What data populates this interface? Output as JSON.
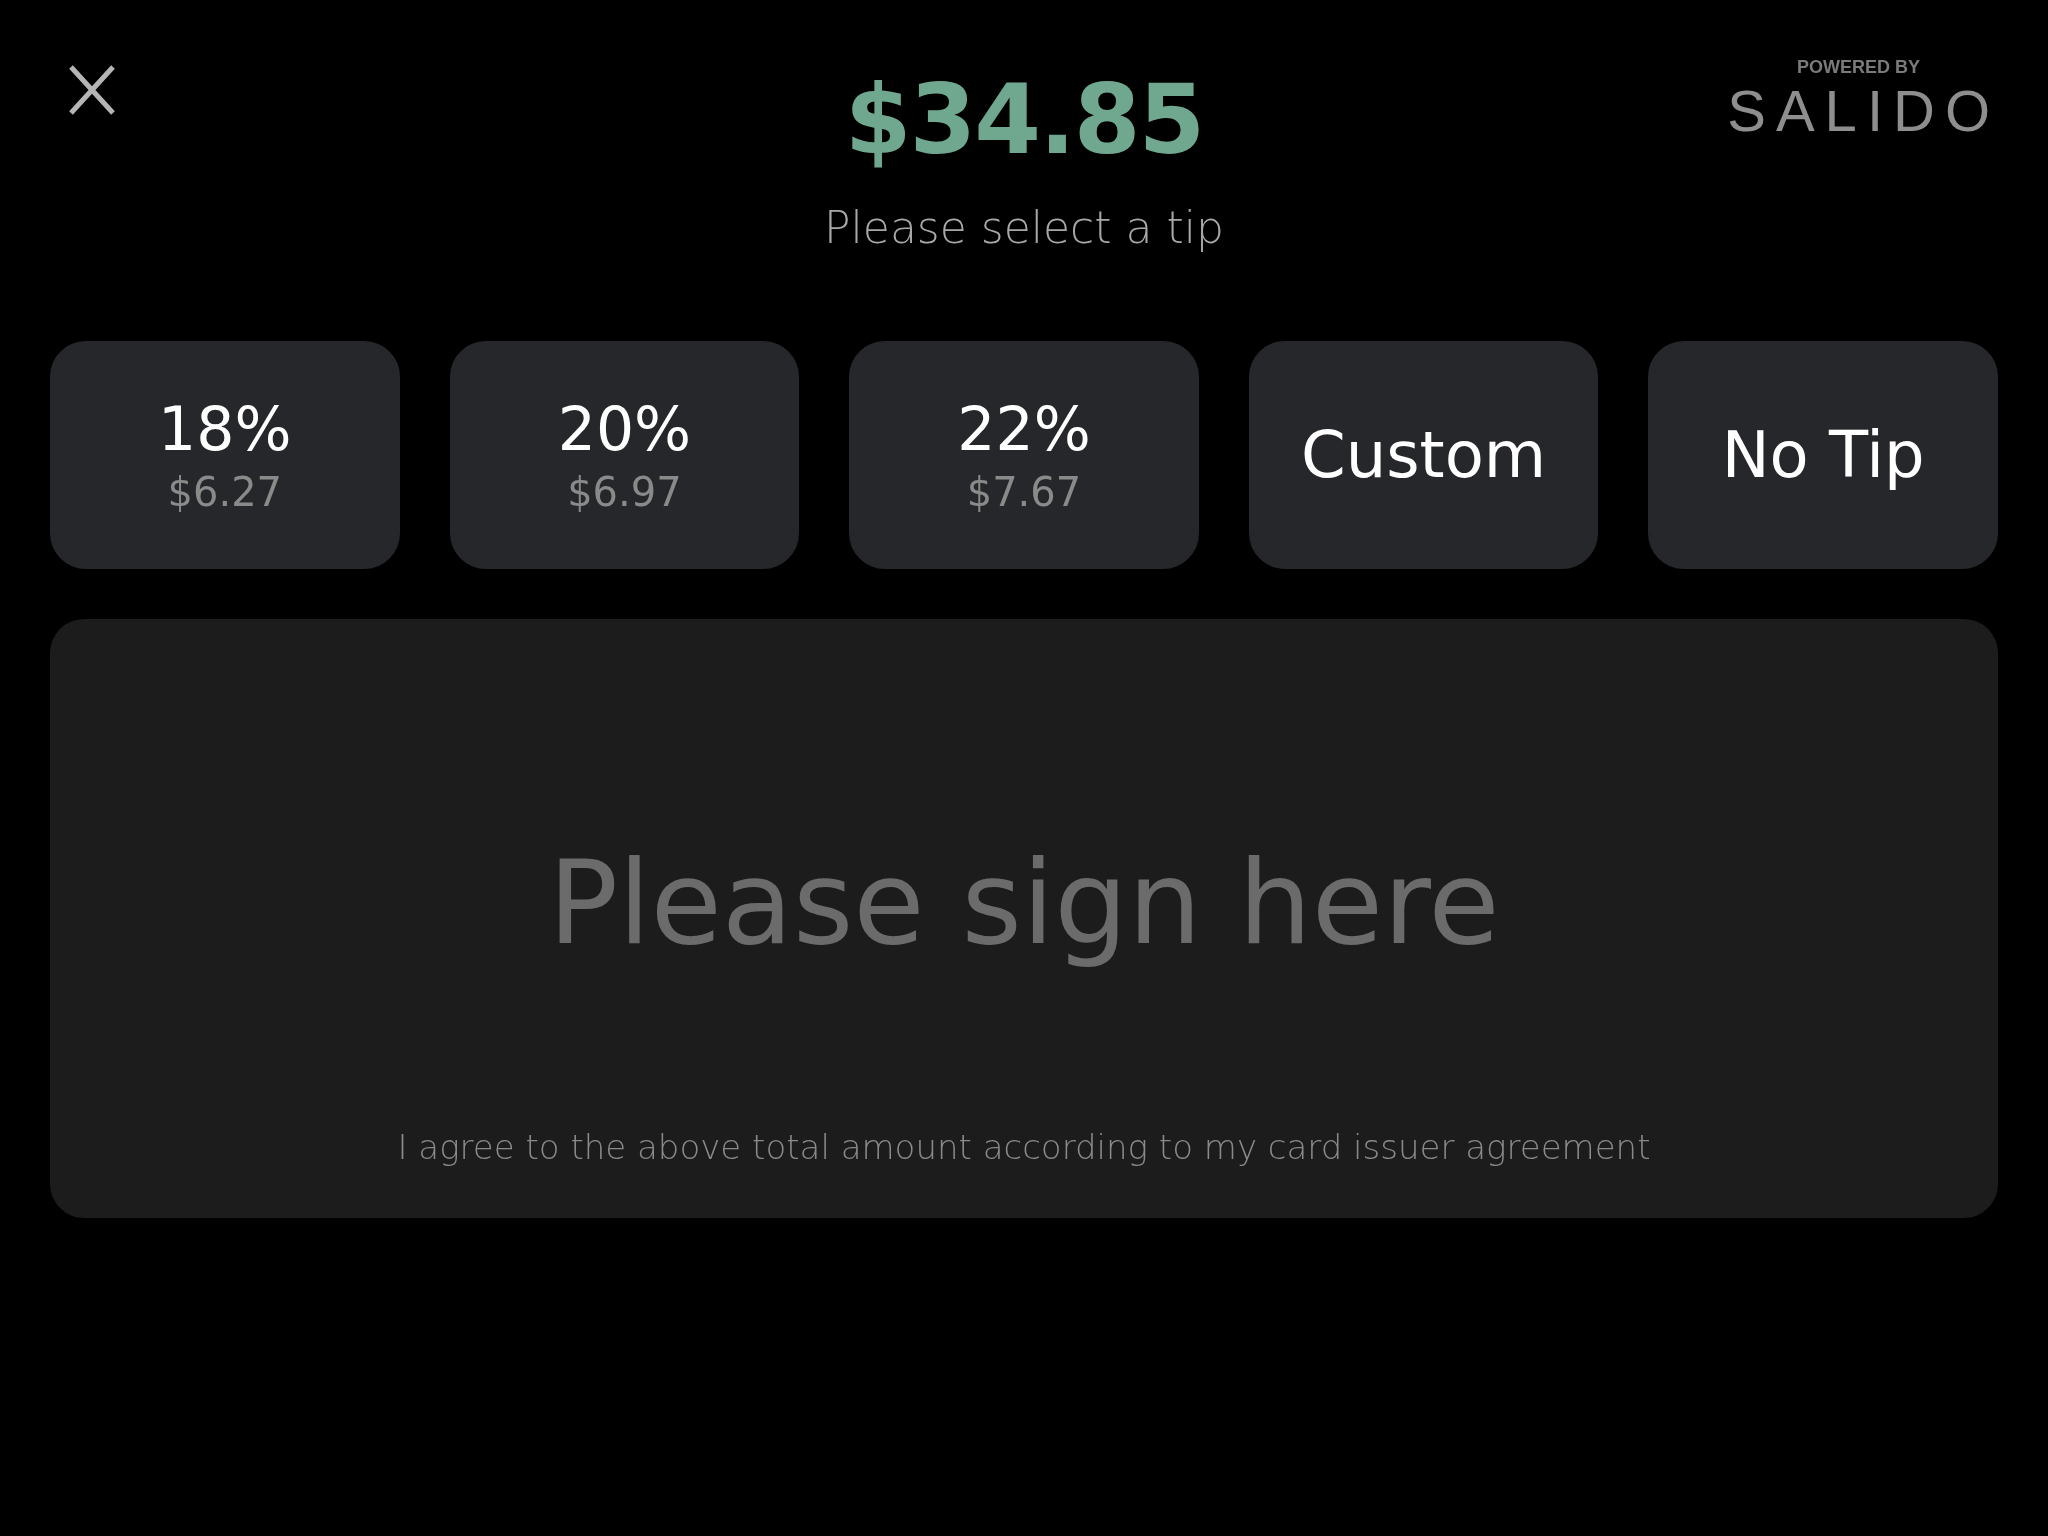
{
  "amount": "$34.85",
  "subtitle": "Please select a tip",
  "branding": {
    "caption": "POWERED BY",
    "logo": "SALIDO"
  },
  "tips": [
    {
      "kind": "percent",
      "label": "18%",
      "amount": "$6.27",
      "selected": false
    },
    {
      "kind": "percent",
      "label": "20%",
      "amount": "$6.97",
      "selected": false
    },
    {
      "kind": "percent",
      "label": "22%",
      "amount": "$7.67",
      "selected": false
    },
    {
      "kind": "plain",
      "label": "Custom",
      "selected": false
    },
    {
      "kind": "plain",
      "label": "No Tip",
      "selected": false
    }
  ],
  "signature": {
    "placeholder": "Please sign here",
    "agreement": "I agree to the above total amount according to my card issuer agreement"
  }
}
